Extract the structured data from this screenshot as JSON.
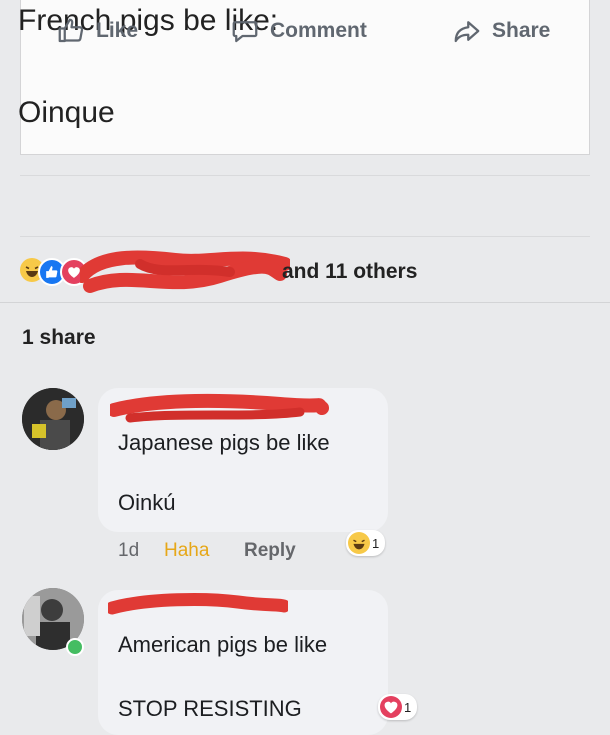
{
  "post": {
    "line1": "French pigs be like:",
    "line2": "Oinque"
  },
  "actions": {
    "like": "Like",
    "comment": "Comment",
    "share": "Share"
  },
  "reactions": {
    "icons": [
      "haha-icon",
      "like-icon",
      "love-icon"
    ],
    "others_text": "and 11 others"
  },
  "shares": "1 share",
  "comments": [
    {
      "line1": "Japanese pigs be like",
      "line2": "Oinkú",
      "age": "1d",
      "haha": "Haha",
      "reply": "Reply",
      "reaction_icon": "haha-icon",
      "reaction_count": "1"
    },
    {
      "line1": "American pigs be like",
      "line2": "STOP RESISTING",
      "reaction_icon": "love-icon",
      "reaction_count": "1",
      "online": true
    }
  ],
  "colors": {
    "text_muted": "#606770",
    "haha": "#e6a718",
    "like_blue": "#1877f2",
    "love_red": "#e4405f",
    "redaction": "#e03a35",
    "online": "#45bd62"
  }
}
